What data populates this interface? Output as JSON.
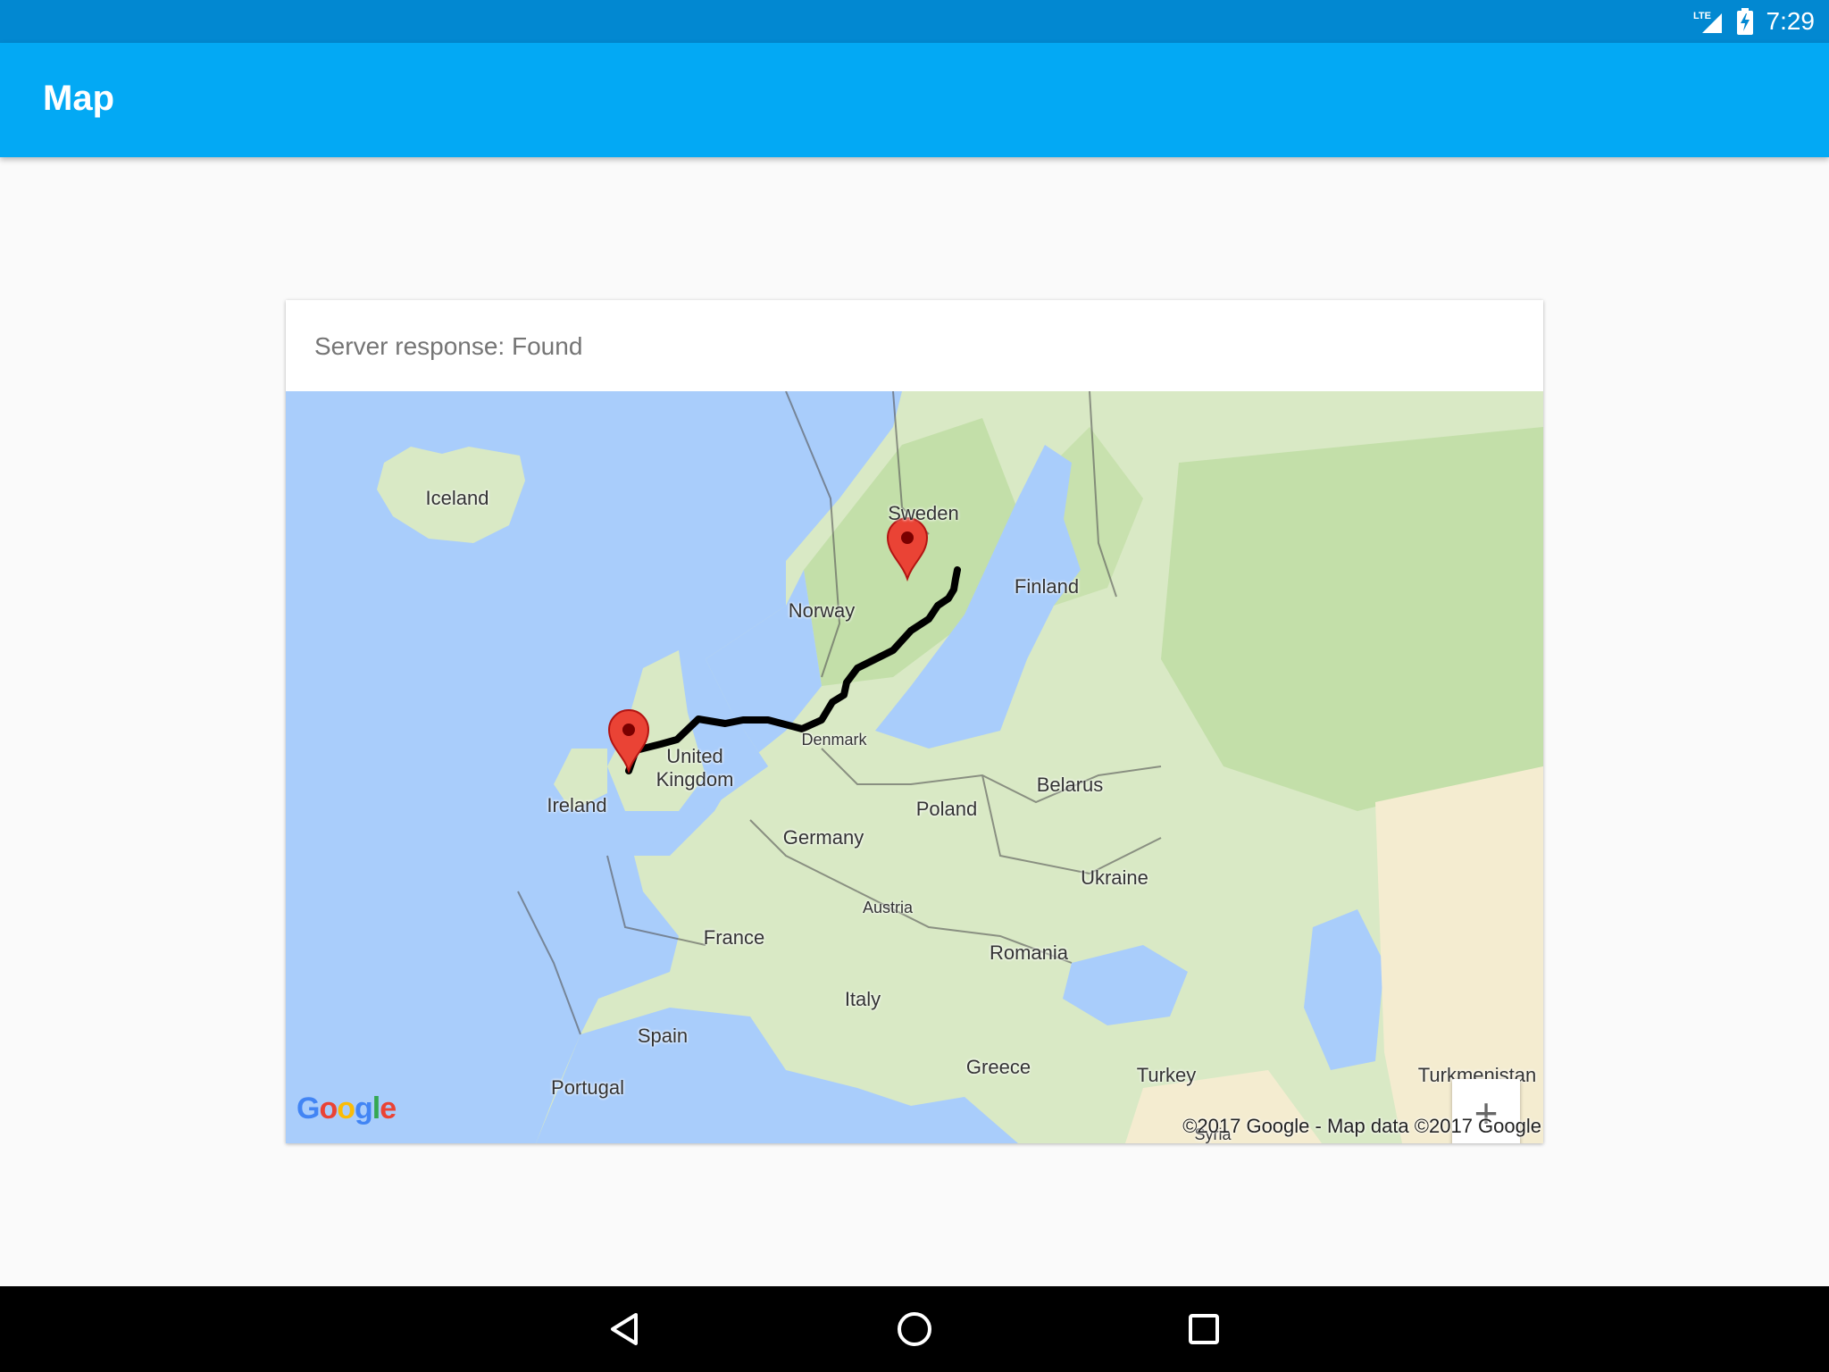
{
  "status_bar": {
    "time": "7:29",
    "network_icon": "lte-signal-icon",
    "network_label": "LTE",
    "battery_icon": "battery-charging-icon"
  },
  "app_bar": {
    "title": "Map"
  },
  "card": {
    "server_response": "Server response: Found"
  },
  "map": {
    "labels": [
      {
        "text": "Iceland",
        "size": "normal"
      },
      {
        "text": "Sweden",
        "size": "normal"
      },
      {
        "text": "Finland",
        "size": "normal"
      },
      {
        "text": "Norway",
        "size": "normal"
      },
      {
        "text": "Denmark",
        "size": "small"
      },
      {
        "text": "United Kingdom",
        "size": "normal"
      },
      {
        "text": "Ireland",
        "size": "normal"
      },
      {
        "text": "Belarus",
        "size": "normal"
      },
      {
        "text": "Poland",
        "size": "normal"
      },
      {
        "text": "Germany",
        "size": "normal"
      },
      {
        "text": "Ukraine",
        "size": "normal"
      },
      {
        "text": "Austria",
        "size": "small"
      },
      {
        "text": "France",
        "size": "normal"
      },
      {
        "text": "Romania",
        "size": "normal"
      },
      {
        "text": "Italy",
        "size": "normal"
      },
      {
        "text": "Spain",
        "size": "normal"
      },
      {
        "text": "Greece",
        "size": "normal"
      },
      {
        "text": "Turkey",
        "size": "normal"
      },
      {
        "text": "Portugal",
        "size": "normal"
      },
      {
        "text": "Turkmenistan",
        "size": "normal"
      },
      {
        "text": "Syria",
        "size": "small"
      }
    ],
    "markers": [
      {
        "name": "marker-start",
        "place": "France"
      },
      {
        "name": "marker-end",
        "place": "Finland"
      }
    ],
    "zoom_in_label": "+",
    "zoom_out_label": "−",
    "logo_text": "Google",
    "copyright": "©2017 Google - Map data ©2017 Google",
    "colors": {
      "water": "#a9cdfb",
      "land": "#d9e9c5",
      "forest": "#c3dfa9",
      "desert": "#f4ecd0",
      "route": "#000000",
      "marker": "#ea4335"
    }
  },
  "nav_bar": {
    "back_icon": "back-icon",
    "home_icon": "home-icon",
    "recents_icon": "recents-icon"
  }
}
